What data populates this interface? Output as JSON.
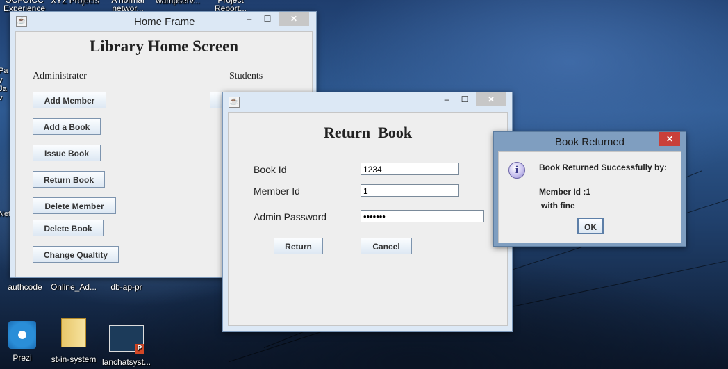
{
  "desktop": {
    "top_icons": [
      "OCFOICC Experience",
      "XYZ Projects",
      "A normal networ...",
      "wampserv...",
      "Project Report..."
    ],
    "side_labels": [
      "Pay Jav",
      "Net"
    ],
    "icons_row1": [
      "authcode",
      "Online_Ad...",
      "db-ap-pr"
    ],
    "icons_row2": [
      "Prezi",
      "st-in-system",
      "lanchatsyst..."
    ]
  },
  "home_frame": {
    "window_title": "Home Frame",
    "heading": "Library Home Screen",
    "admin_label": "Administrater",
    "students_label": "Students",
    "buttons": [
      "Add Member",
      "Add a Book",
      "Issue Book",
      "Return Book",
      "Delete Member",
      "Delete Book",
      "Change Qualtity"
    ]
  },
  "return_book": {
    "heading": "Return  Book",
    "book_id_label": "Book Id",
    "book_id_value": "1234",
    "member_id_label": "Member Id",
    "member_id_value": "1",
    "password_label": "Admin Password",
    "password_value": "•••••••",
    "return_button": "Return",
    "cancel_button": "Cancel"
  },
  "dialog": {
    "title": "Book Returned",
    "message_line1": "Book Returned Successfully by:",
    "message_line2": "Member Id :1",
    "message_line3": "with fine",
    "ok_button": "OK",
    "info_glyph": "i",
    "icon": "info-icon"
  },
  "controls": {
    "minimize": "–",
    "maximize": "☐",
    "close": "✕"
  }
}
